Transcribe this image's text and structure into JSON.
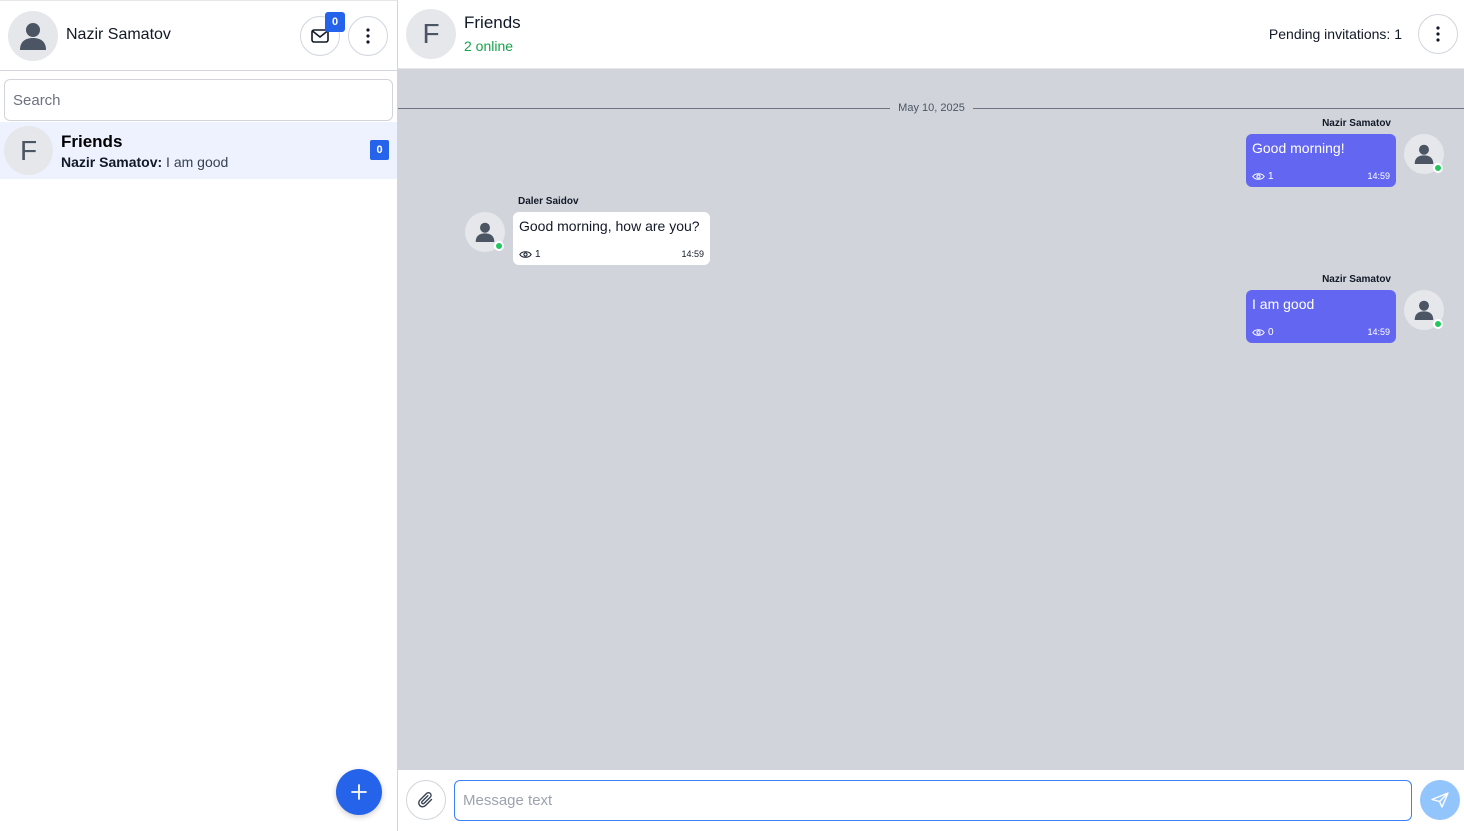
{
  "sidebar": {
    "user_name": "Nazir Samatov",
    "inbox_count": "0",
    "search_placeholder": "Search",
    "chats": [
      {
        "avatar_letter": "F",
        "title": "Friends",
        "preview_author": "Nazir Samatov:",
        "preview_text": " I am good",
        "unread": "0"
      }
    ]
  },
  "header": {
    "avatar_letter": "F",
    "title": "Friends",
    "status": "2 online",
    "pending": "Pending invitations: 1"
  },
  "messages": {
    "date": "May 10, 2025",
    "items": [
      {
        "direction": "out",
        "sender": "Nazir Samatov",
        "text": "Good morning!",
        "views": "1",
        "time": "14:59"
      },
      {
        "direction": "in",
        "sender": "Daler Saidov",
        "text": "Good morning, how are you?",
        "views": "1",
        "time": "14:59"
      },
      {
        "direction": "out",
        "sender": "Nazir Samatov",
        "text": "I am good",
        "views": "0",
        "time": "14:59"
      }
    ]
  },
  "composer": {
    "placeholder": "Message text"
  },
  "colors": {
    "accent": "#2563eb",
    "bubble_out": "#6366f1",
    "online": "#16a34a",
    "chat_bg": "#d1d5db"
  },
  "icons": {
    "user_avatar": "person-icon",
    "inbox": "envelope-icon",
    "menu": "kebab-icon",
    "views": "eye-icon",
    "attach": "paperclip-icon",
    "send": "paper-plane-icon",
    "new_chat": "plus-icon"
  }
}
